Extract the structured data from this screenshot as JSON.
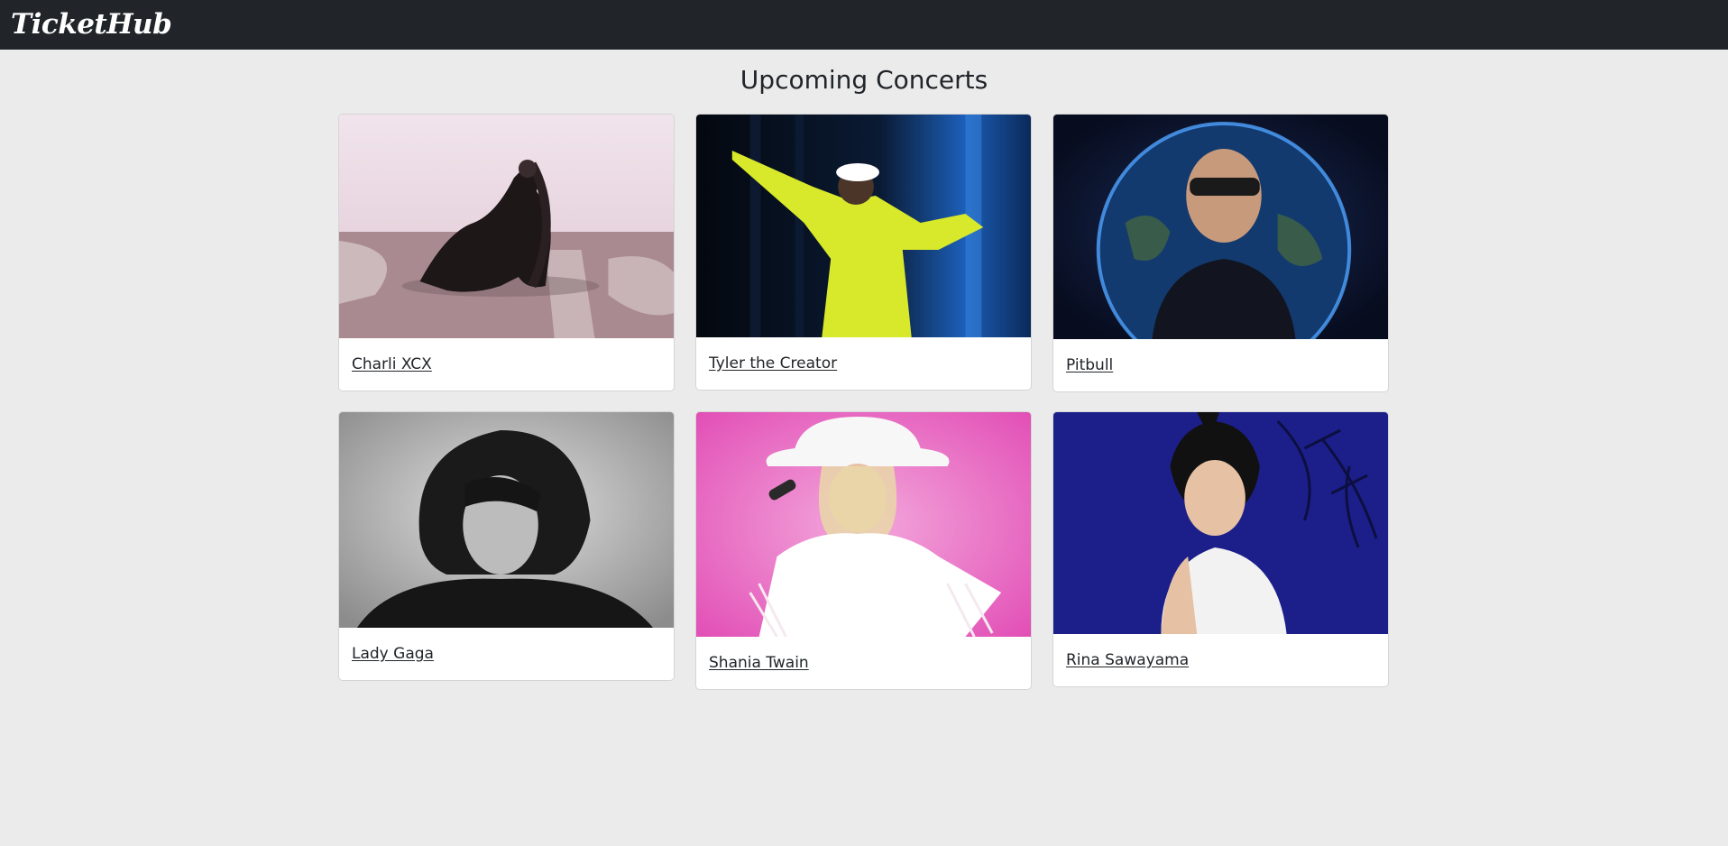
{
  "app": {
    "brand": "TicketHub"
  },
  "page": {
    "title": "Upcoming Concerts"
  },
  "concerts": [
    {
      "name": "Charli XCX"
    },
    {
      "name": "Tyler the Creator"
    },
    {
      "name": "Pitbull"
    },
    {
      "name": "Lady Gaga"
    },
    {
      "name": "Shania Twain"
    },
    {
      "name": "Rina Sawayama"
    }
  ]
}
